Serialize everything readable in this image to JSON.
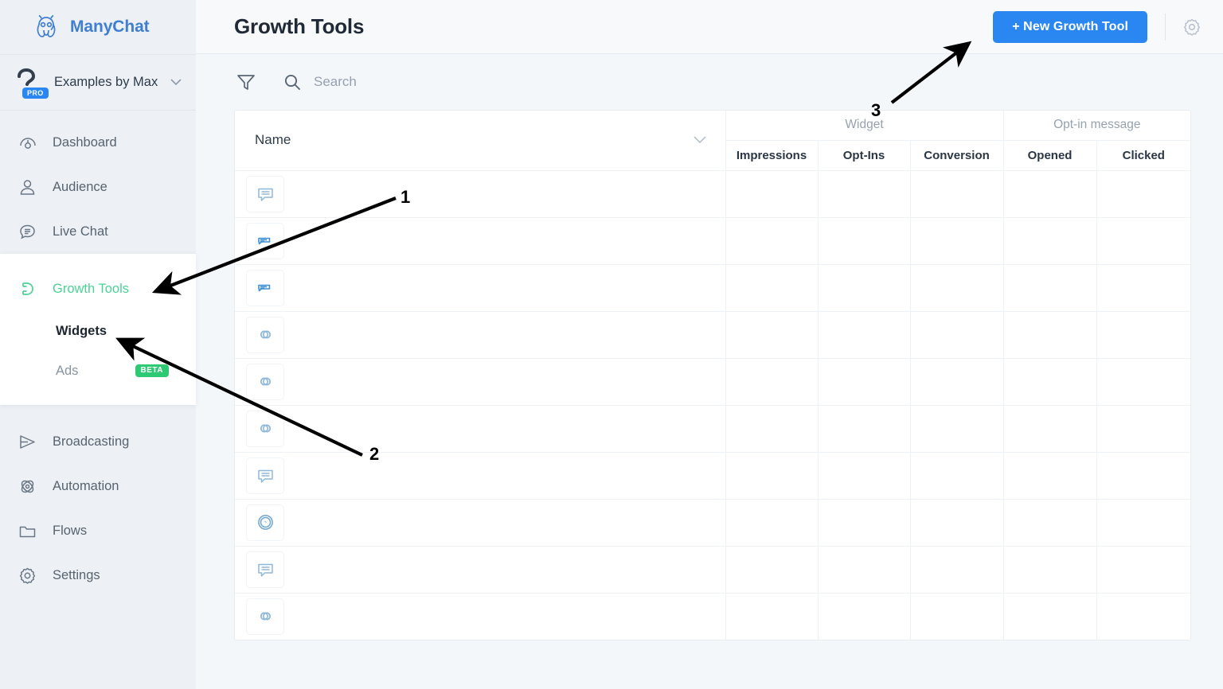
{
  "brand": {
    "name": "ManyChat",
    "logo_icon": "manychat-octopus-logo"
  },
  "account": {
    "name": "Examples by Max",
    "badge": "PRO",
    "avatar_icon": "question-mark-avatar",
    "caret_icon": "chevron-down-icon"
  },
  "sidebar": {
    "primary_items": [
      {
        "label": "Dashboard",
        "icon": "dashboard-gauge-icon"
      },
      {
        "label": "Audience",
        "icon": "person-icon"
      },
      {
        "label": "Live Chat",
        "icon": "chat-bubble-icon"
      }
    ],
    "growth_section": {
      "label": "Growth Tools",
      "icon": "magnet-icon",
      "active_color": "#4ad295",
      "sub_items": [
        {
          "label": "Widgets",
          "current": true,
          "badge": ""
        },
        {
          "label": "Ads",
          "current": false,
          "badge": "BETA"
        }
      ]
    },
    "secondary_items": [
      {
        "label": "Broadcasting",
        "icon": "send-paper-plane-icon"
      },
      {
        "label": "Automation",
        "icon": "atom-icon"
      },
      {
        "label": "Flows",
        "icon": "folder-icon"
      },
      {
        "label": "Settings",
        "icon": "gear-icon"
      }
    ]
  },
  "header": {
    "title": "Growth Tools",
    "new_button_label": "+ New Growth Tool",
    "new_button_color": "#2a86f0",
    "settings_icon": "gear-icon"
  },
  "toolbar": {
    "filter_icon": "filter-funnel-icon",
    "search_icon": "search-icon",
    "search_placeholder": "Search",
    "search_value": ""
  },
  "table": {
    "name_column": {
      "label": "Name",
      "sort_icon": "chevron-down-icon"
    },
    "groups": [
      {
        "label": "Widget",
        "span": 3
      },
      {
        "label": "Opt-in message",
        "span": 2
      }
    ],
    "metric_columns": [
      "Impressions",
      "Opt-Ins",
      "Conversion",
      "Opened",
      "Clicked"
    ],
    "rows": [
      {
        "icon": "chat-bubble-icon",
        "name": "",
        "impressions": "",
        "opt_ins": "",
        "conversion": "",
        "opened": "",
        "clicked": ""
      },
      {
        "icon": "bar-widget-icon",
        "name": "",
        "impressions": "",
        "opt_ins": "",
        "conversion": "",
        "opened": "",
        "clicked": ""
      },
      {
        "icon": "bar-widget-icon",
        "name": "",
        "impressions": "",
        "opt_ins": "",
        "conversion": "",
        "opened": "",
        "clicked": ""
      },
      {
        "icon": "link-icon",
        "name": "",
        "impressions": "",
        "opt_ins": "",
        "conversion": "",
        "opened": "",
        "clicked": ""
      },
      {
        "icon": "link-icon",
        "name": "",
        "impressions": "",
        "opt_ins": "",
        "conversion": "",
        "opened": "",
        "clicked": ""
      },
      {
        "icon": "link-icon",
        "name": "",
        "impressions": "",
        "opt_ins": "",
        "conversion": "",
        "opened": "",
        "clicked": ""
      },
      {
        "icon": "chat-bubble-icon",
        "name": "",
        "impressions": "",
        "opt_ins": "",
        "conversion": "",
        "opened": "",
        "clicked": ""
      },
      {
        "icon": "messenger-circle-icon",
        "name": "",
        "impressions": "",
        "opt_ins": "",
        "conversion": "",
        "opened": "",
        "clicked": ""
      },
      {
        "icon": "chat-bubble-icon",
        "name": "",
        "impressions": "",
        "opt_ins": "",
        "conversion": "",
        "opened": "",
        "clicked": ""
      },
      {
        "icon": "link-icon",
        "name": "",
        "impressions": "",
        "opt_ins": "",
        "conversion": "",
        "opened": "",
        "clicked": ""
      }
    ]
  },
  "annotations": [
    {
      "number": "1",
      "target": "Growth Tools sidebar item"
    },
    {
      "number": "2",
      "target": "Widgets sidebar sub-item"
    },
    {
      "number": "3",
      "target": "+ New Growth Tool button"
    }
  ]
}
